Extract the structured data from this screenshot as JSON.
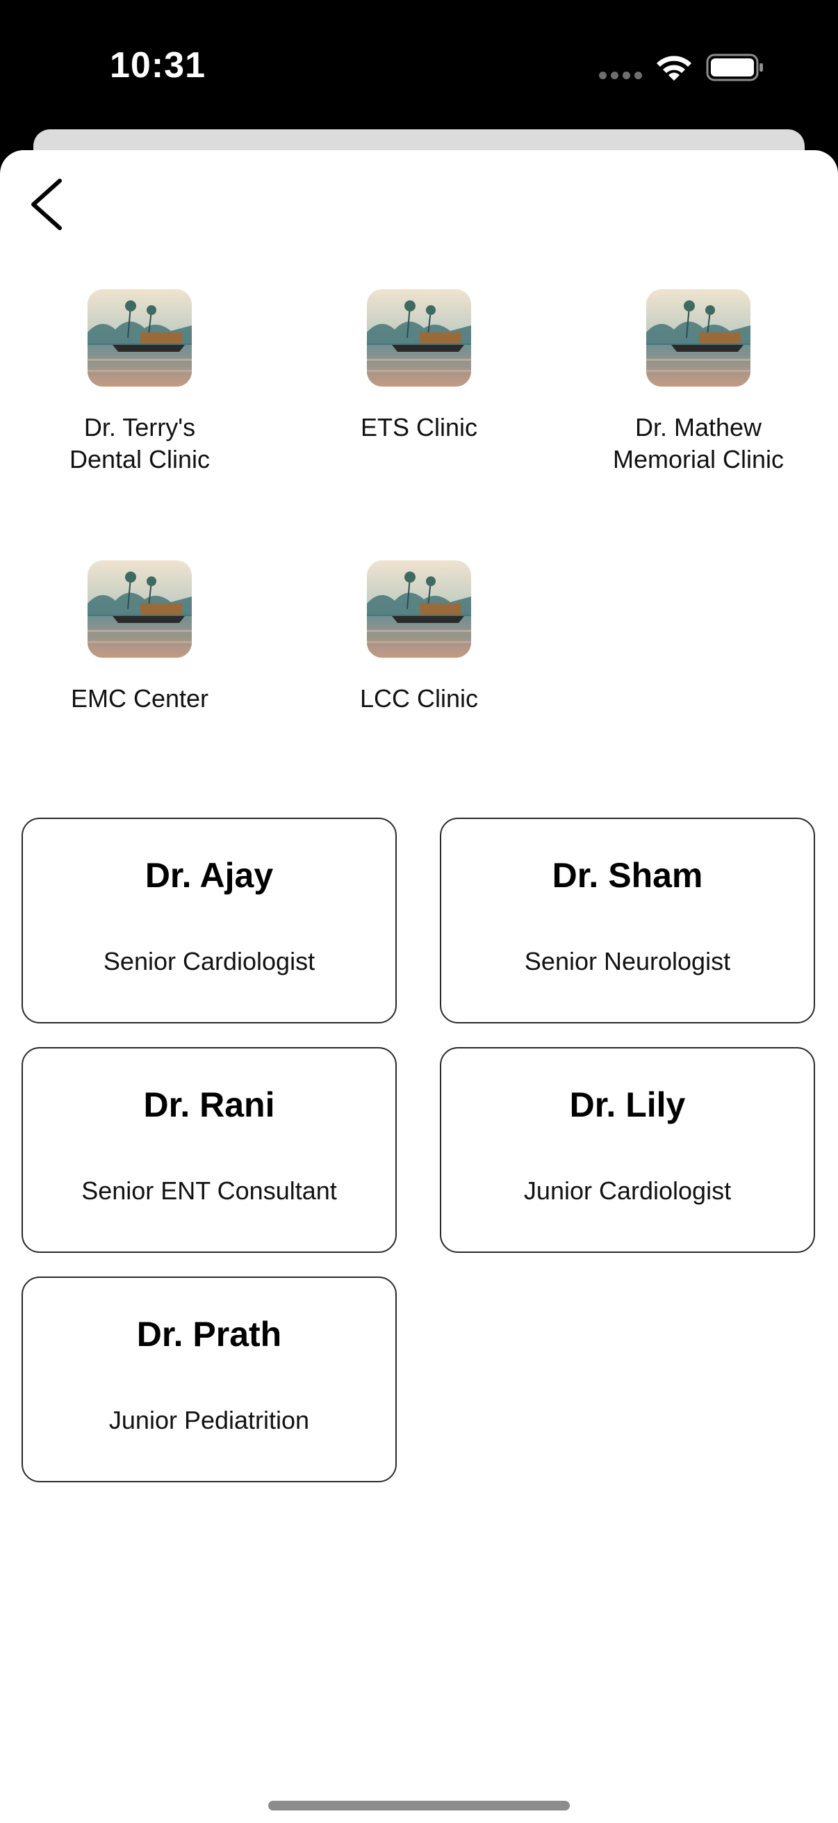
{
  "status_bar": {
    "time": "10:31"
  },
  "clinics": [
    {
      "label": "Dr. Terry's\nDental Clinic",
      "icon": "houseboat-lagoon-image"
    },
    {
      "label": "ETS Clinic",
      "icon": "houseboat-lagoon-image"
    },
    {
      "label": "Dr. Mathew\nMemorial Clinic",
      "icon": "houseboat-lagoon-image"
    },
    {
      "label": "EMC Center",
      "icon": "houseboat-lagoon-image"
    },
    {
      "label": "LCC Clinic",
      "icon": "houseboat-lagoon-image"
    }
  ],
  "doctors": [
    {
      "name": "Dr. Ajay",
      "role": "Senior Cardiologist"
    },
    {
      "name": "Dr. Sham",
      "role": "Senior Neurologist"
    },
    {
      "name": "Dr. Rani",
      "role": "Senior ENT Consultant"
    },
    {
      "name": "Dr. Lily",
      "role": "Junior Cardiologist"
    },
    {
      "name": "Dr. Prath",
      "role": "Junior Pediatrition"
    }
  ],
  "icons": {
    "back": "chevron-left-icon"
  }
}
